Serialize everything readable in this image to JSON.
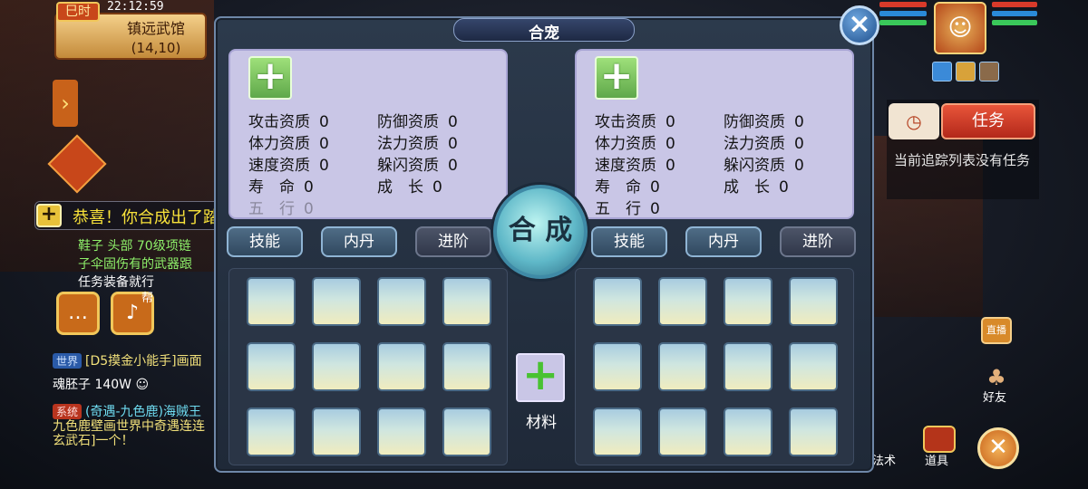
{
  "status_bar": {
    "time_badge": "巳时",
    "clock": "22:12:59"
  },
  "location": {
    "name": "镇远武馆",
    "coord": "(14,10)"
  },
  "notice": {
    "icon": "plus-icon",
    "text": "恭喜！你合成出了踏云兽。"
  },
  "chat": {
    "quest_lines": [
      "鞋子 头部 70级项链",
      "子伞固伤有的武器跟",
      "任务装备就行"
    ],
    "mic_tag": "帮",
    "world_tag": "世界",
    "world_user": "[D5摸金小能手]",
    "world_cut": "画面",
    "world_msg": "魂胚子 140W",
    "sys_tag": "系统",
    "sys_link": "(奇遇-九色鹿)",
    "sys_cut": "海贼王",
    "sys_msg1": "九色鹿壁画世界中奇遇连连",
    "sys_msg2": "玄武石]一个！"
  },
  "dialog": {
    "title": "合宠",
    "merge_label": "合 成",
    "material_label": "材料",
    "left": {
      "stats": [
        {
          "label": "攻击资质",
          "value": "0"
        },
        {
          "label": "防御资质",
          "value": "0"
        },
        {
          "label": "体力资质",
          "value": "0"
        },
        {
          "label": "法力资质",
          "value": "0"
        },
        {
          "label": "速度资质",
          "value": "0"
        },
        {
          "label": "躲闪资质",
          "value": "0"
        },
        {
          "label": "寿　命",
          "value": "0"
        },
        {
          "label": "成　长",
          "value": "0"
        },
        {
          "label": "五　行",
          "value": "0"
        }
      ],
      "tabs": [
        "技能",
        "内丹",
        "进阶"
      ]
    },
    "right": {
      "stats": [
        {
          "label": "攻击资质",
          "value": "0"
        },
        {
          "label": "防御资质",
          "value": "0"
        },
        {
          "label": "体力资质",
          "value": "0"
        },
        {
          "label": "法力资质",
          "value": "0"
        },
        {
          "label": "速度资质",
          "value": "0"
        },
        {
          "label": "躲闪资质",
          "value": "0"
        },
        {
          "label": "寿　命",
          "value": "0"
        },
        {
          "label": "成　长",
          "value": "0"
        },
        {
          "label": "五　行",
          "value": "0"
        }
      ],
      "tabs": [
        "技能",
        "内丹",
        "进阶"
      ]
    }
  },
  "right_panel": {
    "task_label": "任务",
    "task_empty": "当前追踪列表没有任务",
    "tv_label": "直播",
    "friend_label": "好友",
    "spell_label": "法术",
    "prop_label": "道具"
  },
  "colors": {
    "notice_text": "#f8e23a",
    "stat_panel": "#c9c6e6",
    "accent_green": "#49c232"
  }
}
